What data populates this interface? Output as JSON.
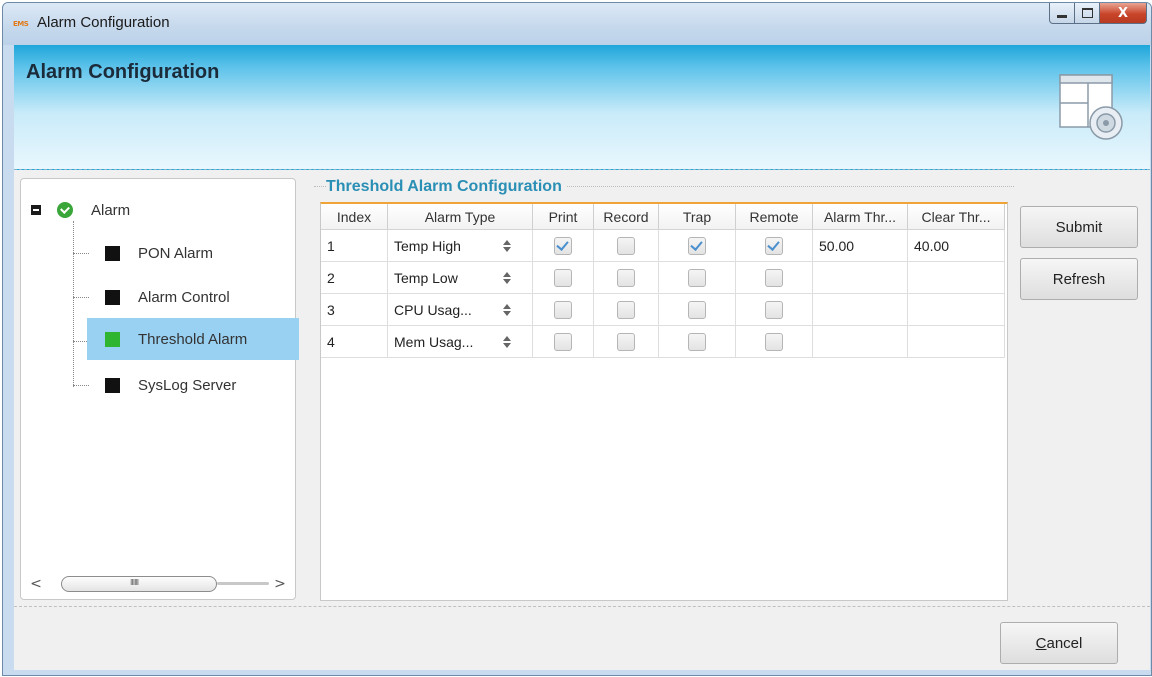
{
  "window": {
    "title": "Alarm Configuration",
    "app_icon_text": "EMS",
    "minimize_symbol": "—",
    "maximize_symbol": "□",
    "close_symbol": "X"
  },
  "header": {
    "title": "Alarm Configuration",
    "icon": "config-dialog-icon"
  },
  "tree": {
    "root": {
      "label": "Alarm",
      "expander": "minus",
      "icon": "green-check-icon"
    },
    "items": [
      {
        "label": "PON Alarm",
        "color": "#111111",
        "selected": false
      },
      {
        "label": "Alarm Control",
        "color": "#111111",
        "selected": false
      },
      {
        "label": "Threshold Alarm",
        "color": "#2fb52f",
        "selected": true
      },
      {
        "label": "SysLog Server",
        "color": "#111111",
        "selected": false
      }
    ],
    "scroll_left": "<",
    "scroll_right": ">",
    "thumb_grip": "IIIIII"
  },
  "group": {
    "title": "Threshold Alarm Configuration"
  },
  "table": {
    "columns": [
      "Index",
      "Alarm Type",
      "Print",
      "Record",
      "Trap",
      "Remote",
      "Alarm Thr...",
      "Clear Thr..."
    ],
    "rows": [
      {
        "index": "1",
        "type": "Temp High",
        "print": true,
        "record": false,
        "trap": true,
        "remote": true,
        "alarm_thr": "50.00",
        "clear_thr": "40.00"
      },
      {
        "index": "2",
        "type": "Temp Low",
        "print": false,
        "record": false,
        "trap": false,
        "remote": false,
        "alarm_thr": "",
        "clear_thr": ""
      },
      {
        "index": "3",
        "type": "CPU Usag...",
        "print": false,
        "record": false,
        "trap": false,
        "remote": false,
        "alarm_thr": "",
        "clear_thr": ""
      },
      {
        "index": "4",
        "type": "Mem Usag...",
        "print": false,
        "record": false,
        "trap": false,
        "remote": false,
        "alarm_thr": "",
        "clear_thr": ""
      }
    ]
  },
  "buttons": {
    "submit": "Submit",
    "refresh": "Refresh",
    "cancel_prefix": "C",
    "cancel_rest": "ancel"
  },
  "colors": {
    "banner": "#1fa6da",
    "group_title": "#2a8fb5",
    "selection": "#99d1f2",
    "table_accent": "#f0a438"
  }
}
